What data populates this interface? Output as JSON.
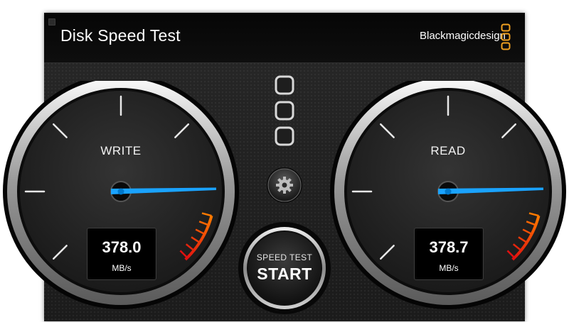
{
  "window": {
    "title": "Disk Speed Test"
  },
  "brand": {
    "name": "Blackmagicdesign",
    "logo_icon": "blackmagic-logo-icon",
    "accent": "#f0a020"
  },
  "gauges": {
    "write": {
      "label": "WRITE",
      "value": "378.0",
      "unit": "MB/s"
    },
    "read": {
      "label": "READ",
      "value": "378.7",
      "unit": "MB/s"
    }
  },
  "progress_indicator": {
    "steps": 3,
    "completed": 0
  },
  "settings": {
    "icon": "gear-icon"
  },
  "start_button": {
    "subtitle": "SPEED TEST",
    "label": "START"
  },
  "colors": {
    "needle": "#1aa3ff",
    "red_zone_start": "#ff7a00",
    "red_zone_end": "#e01010"
  }
}
